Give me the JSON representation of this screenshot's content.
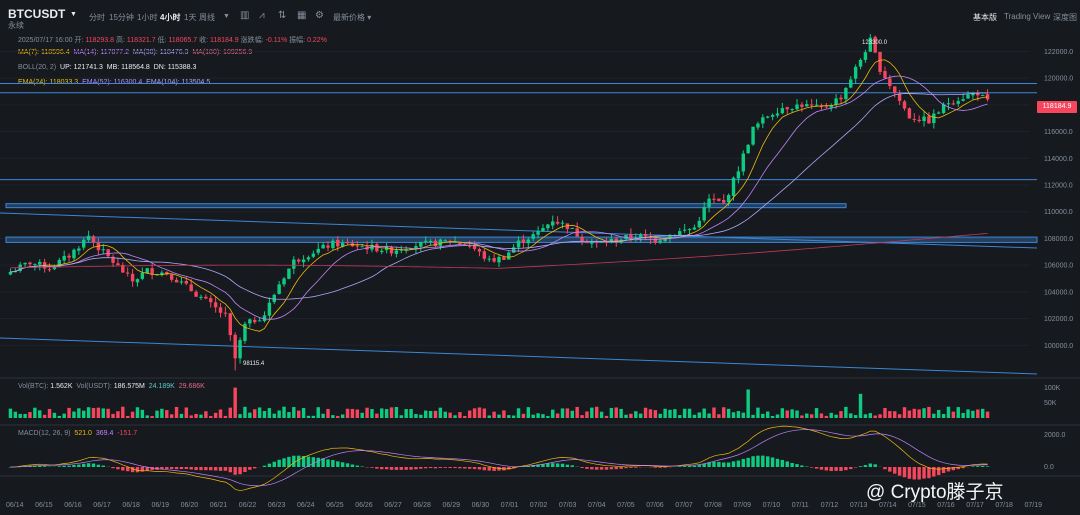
{
  "header": {
    "symbol": "BTCUSDT",
    "contract_type": "永续",
    "timeframes": [
      "分时",
      "15分钟",
      "1小时",
      "4小时",
      "1天",
      "周线"
    ],
    "active_timeframe": "4小时",
    "price_type": "最新价格",
    "views": [
      "基本版",
      "Trading View",
      "深度图"
    ],
    "active_view": "基本版"
  },
  "ohlc": {
    "date": "2025/07/17 16:00",
    "open_label": "开:",
    "open": "118293.8",
    "high_label": "高:",
    "high": "118321.7",
    "low_label": "低:",
    "low": "118065.7",
    "close_label": "收:",
    "close": "118184.9",
    "change_label": "涨跌幅:",
    "change": "-0.11%",
    "amplitude_label": "振幅:",
    "amplitude": "0.22%"
  },
  "ma": {
    "ma7": "MA(7): 118596.4",
    "ma14": "MA(14): 117877.2",
    "ma30": "MA(30): 118476.3",
    "ma180": "MA(180): 109256.9"
  },
  "boll": {
    "title": "BOLL(20, 2)",
    "up": "UP: 121741.3",
    "mb": "MB: 118564.8",
    "dn": "DN: 115388.3"
  },
  "ema": {
    "ema24": "EMA(24): 118033.3",
    "ema52": "EMA(52): 116300.4",
    "ema104": "EMA(104): 113504.5"
  },
  "volume": {
    "title": "Vol(BTC):",
    "btc": "1.562K",
    "usdt_label": "Vol(USDT):",
    "usdt": "186.575M",
    "ma1": "24.189K",
    "ma2": "29.686K",
    "axis": [
      "100K",
      "50K"
    ]
  },
  "macd": {
    "title": "MACD(12, 26, 9)",
    "macd": "521.0",
    "signal": "369.4",
    "hist": "-151.7",
    "axis": [
      "2000.0",
      "0.0"
    ]
  },
  "annotations": {
    "high": "123300.0",
    "low": "98115.4",
    "last_price": "118184.9"
  },
  "watermark_text": "@ Crypto滕子京",
  "colors": {
    "up": "#0ecb81",
    "down": "#f6465d",
    "background": "#161a1e",
    "trendline": "#3a86d8"
  },
  "chart_data": {
    "type": "candlestick",
    "y_ticks": [
      122000,
      120000,
      118000,
      116000,
      114000,
      112000,
      110000,
      108000,
      106000,
      104000,
      102000,
      100000
    ],
    "ylim": [
      98000,
      123600
    ],
    "x_tick_labels": [
      "06/14",
      "06/15",
      "06/16",
      "06/17",
      "06/18",
      "06/19",
      "06/20",
      "06/21",
      "06/22",
      "06/23",
      "06/24",
      "06/25",
      "06/26",
      "06/27",
      "06/28",
      "06/29",
      "06/30",
      "07/01",
      "07/02",
      "07/03",
      "07/04",
      "07/05",
      "07/06",
      "07/07",
      "07/08",
      "07/09",
      "07/10",
      "07/11",
      "07/12",
      "07/13",
      "07/14",
      "07/15",
      "07/16",
      "07/17",
      "07/18",
      "07/19"
    ],
    "horizontal_levels": [
      119600,
      118900,
      112400
    ],
    "support_zones": [
      [
        110300,
        110600
      ],
      [
        107700,
        108100
      ]
    ],
    "close_anchors": [
      [
        0,
        105500
      ],
      [
        4,
        106200
      ],
      [
        8,
        105800
      ],
      [
        12,
        106700
      ],
      [
        16,
        108200
      ],
      [
        18,
        107300
      ],
      [
        20,
        106600
      ],
      [
        25,
        104800
      ],
      [
        28,
        105600
      ],
      [
        32,
        105400
      ],
      [
        36,
        104400
      ],
      [
        40,
        103300
      ],
      [
        44,
        102200
      ],
      [
        46,
        99000
      ],
      [
        48,
        101500
      ],
      [
        52,
        102300
      ],
      [
        55,
        104600
      ],
      [
        58,
        106300
      ],
      [
        62,
        107000
      ],
      [
        66,
        107600
      ],
      [
        70,
        107500
      ],
      [
        74,
        107300
      ],
      [
        78,
        107100
      ],
      [
        82,
        107500
      ],
      [
        86,
        107600
      ],
      [
        90,
        107800
      ],
      [
        94,
        107500
      ],
      [
        98,
        106300
      ],
      [
        101,
        106600
      ],
      [
        104,
        107700
      ],
      [
        108,
        108400
      ],
      [
        111,
        109400
      ],
      [
        114,
        108900
      ],
      [
        117,
        108000
      ],
      [
        120,
        107600
      ],
      [
        124,
        107900
      ],
      [
        128,
        108200
      ],
      [
        132,
        107900
      ],
      [
        136,
        108400
      ],
      [
        140,
        108800
      ],
      [
        143,
        110900
      ],
      [
        146,
        110600
      ],
      [
        149,
        113200
      ],
      [
        152,
        116200
      ],
      [
        155,
        117200
      ],
      [
        158,
        117800
      ],
      [
        162,
        118000
      ],
      [
        166,
        117700
      ],
      [
        170,
        118600
      ],
      [
        174,
        121400
      ],
      [
        176,
        122800
      ],
      [
        178,
        120700
      ],
      [
        181,
        118900
      ],
      [
        184,
        117100
      ],
      [
        188,
        116800
      ],
      [
        192,
        118200
      ],
      [
        196,
        118700
      ],
      [
        198,
        118900
      ],
      [
        200,
        118200
      ]
    ],
    "volume_range_k": [
      0,
      100
    ],
    "macd_axis": [
      0,
      2000
    ]
  }
}
